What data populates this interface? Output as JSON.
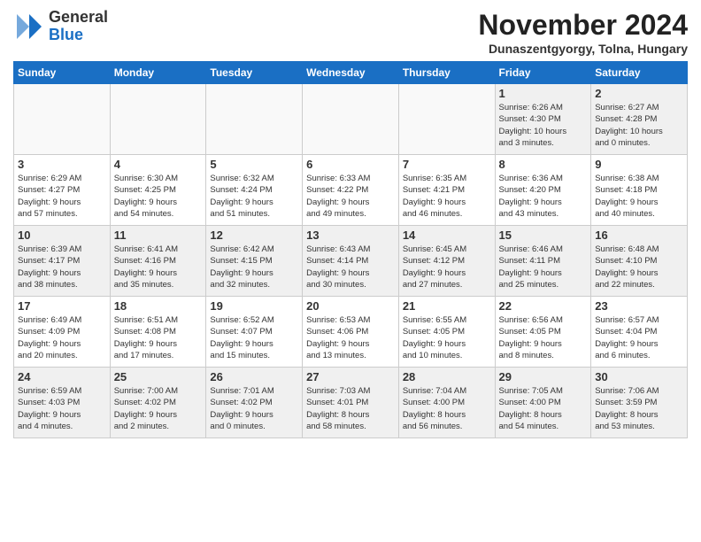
{
  "logo": {
    "general": "General",
    "blue": "Blue"
  },
  "title": "November 2024",
  "location": "Dunaszentgyorgy, Tolna, Hungary",
  "days_header": [
    "Sunday",
    "Monday",
    "Tuesday",
    "Wednesday",
    "Thursday",
    "Friday",
    "Saturday"
  ],
  "weeks": [
    [
      {
        "day": "",
        "info": "",
        "empty": true
      },
      {
        "day": "",
        "info": "",
        "empty": true
      },
      {
        "day": "",
        "info": "",
        "empty": true
      },
      {
        "day": "",
        "info": "",
        "empty": true
      },
      {
        "day": "",
        "info": "",
        "empty": true
      },
      {
        "day": "1",
        "info": "Sunrise: 6:26 AM\nSunset: 4:30 PM\nDaylight: 10 hours\nand 3 minutes."
      },
      {
        "day": "2",
        "info": "Sunrise: 6:27 AM\nSunset: 4:28 PM\nDaylight: 10 hours\nand 0 minutes."
      }
    ],
    [
      {
        "day": "3",
        "info": "Sunrise: 6:29 AM\nSunset: 4:27 PM\nDaylight: 9 hours\nand 57 minutes."
      },
      {
        "day": "4",
        "info": "Sunrise: 6:30 AM\nSunset: 4:25 PM\nDaylight: 9 hours\nand 54 minutes."
      },
      {
        "day": "5",
        "info": "Sunrise: 6:32 AM\nSunset: 4:24 PM\nDaylight: 9 hours\nand 51 minutes."
      },
      {
        "day": "6",
        "info": "Sunrise: 6:33 AM\nSunset: 4:22 PM\nDaylight: 9 hours\nand 49 minutes."
      },
      {
        "day": "7",
        "info": "Sunrise: 6:35 AM\nSunset: 4:21 PM\nDaylight: 9 hours\nand 46 minutes."
      },
      {
        "day": "8",
        "info": "Sunrise: 6:36 AM\nSunset: 4:20 PM\nDaylight: 9 hours\nand 43 minutes."
      },
      {
        "day": "9",
        "info": "Sunrise: 6:38 AM\nSunset: 4:18 PM\nDaylight: 9 hours\nand 40 minutes."
      }
    ],
    [
      {
        "day": "10",
        "info": "Sunrise: 6:39 AM\nSunset: 4:17 PM\nDaylight: 9 hours\nand 38 minutes."
      },
      {
        "day": "11",
        "info": "Sunrise: 6:41 AM\nSunset: 4:16 PM\nDaylight: 9 hours\nand 35 minutes."
      },
      {
        "day": "12",
        "info": "Sunrise: 6:42 AM\nSunset: 4:15 PM\nDaylight: 9 hours\nand 32 minutes."
      },
      {
        "day": "13",
        "info": "Sunrise: 6:43 AM\nSunset: 4:14 PM\nDaylight: 9 hours\nand 30 minutes."
      },
      {
        "day": "14",
        "info": "Sunrise: 6:45 AM\nSunset: 4:12 PM\nDaylight: 9 hours\nand 27 minutes."
      },
      {
        "day": "15",
        "info": "Sunrise: 6:46 AM\nSunset: 4:11 PM\nDaylight: 9 hours\nand 25 minutes."
      },
      {
        "day": "16",
        "info": "Sunrise: 6:48 AM\nSunset: 4:10 PM\nDaylight: 9 hours\nand 22 minutes."
      }
    ],
    [
      {
        "day": "17",
        "info": "Sunrise: 6:49 AM\nSunset: 4:09 PM\nDaylight: 9 hours\nand 20 minutes."
      },
      {
        "day": "18",
        "info": "Sunrise: 6:51 AM\nSunset: 4:08 PM\nDaylight: 9 hours\nand 17 minutes."
      },
      {
        "day": "19",
        "info": "Sunrise: 6:52 AM\nSunset: 4:07 PM\nDaylight: 9 hours\nand 15 minutes."
      },
      {
        "day": "20",
        "info": "Sunrise: 6:53 AM\nSunset: 4:06 PM\nDaylight: 9 hours\nand 13 minutes."
      },
      {
        "day": "21",
        "info": "Sunrise: 6:55 AM\nSunset: 4:05 PM\nDaylight: 9 hours\nand 10 minutes."
      },
      {
        "day": "22",
        "info": "Sunrise: 6:56 AM\nSunset: 4:05 PM\nDaylight: 9 hours\nand 8 minutes."
      },
      {
        "day": "23",
        "info": "Sunrise: 6:57 AM\nSunset: 4:04 PM\nDaylight: 9 hours\nand 6 minutes."
      }
    ],
    [
      {
        "day": "24",
        "info": "Sunrise: 6:59 AM\nSunset: 4:03 PM\nDaylight: 9 hours\nand 4 minutes."
      },
      {
        "day": "25",
        "info": "Sunrise: 7:00 AM\nSunset: 4:02 PM\nDaylight: 9 hours\nand 2 minutes."
      },
      {
        "day": "26",
        "info": "Sunrise: 7:01 AM\nSunset: 4:02 PM\nDaylight: 9 hours\nand 0 minutes."
      },
      {
        "day": "27",
        "info": "Sunrise: 7:03 AM\nSunset: 4:01 PM\nDaylight: 8 hours\nand 58 minutes."
      },
      {
        "day": "28",
        "info": "Sunrise: 7:04 AM\nSunset: 4:00 PM\nDaylight: 8 hours\nand 56 minutes."
      },
      {
        "day": "29",
        "info": "Sunrise: 7:05 AM\nSunset: 4:00 PM\nDaylight: 8 hours\nand 54 minutes."
      },
      {
        "day": "30",
        "info": "Sunrise: 7:06 AM\nSunset: 3:59 PM\nDaylight: 8 hours\nand 53 minutes."
      }
    ]
  ]
}
